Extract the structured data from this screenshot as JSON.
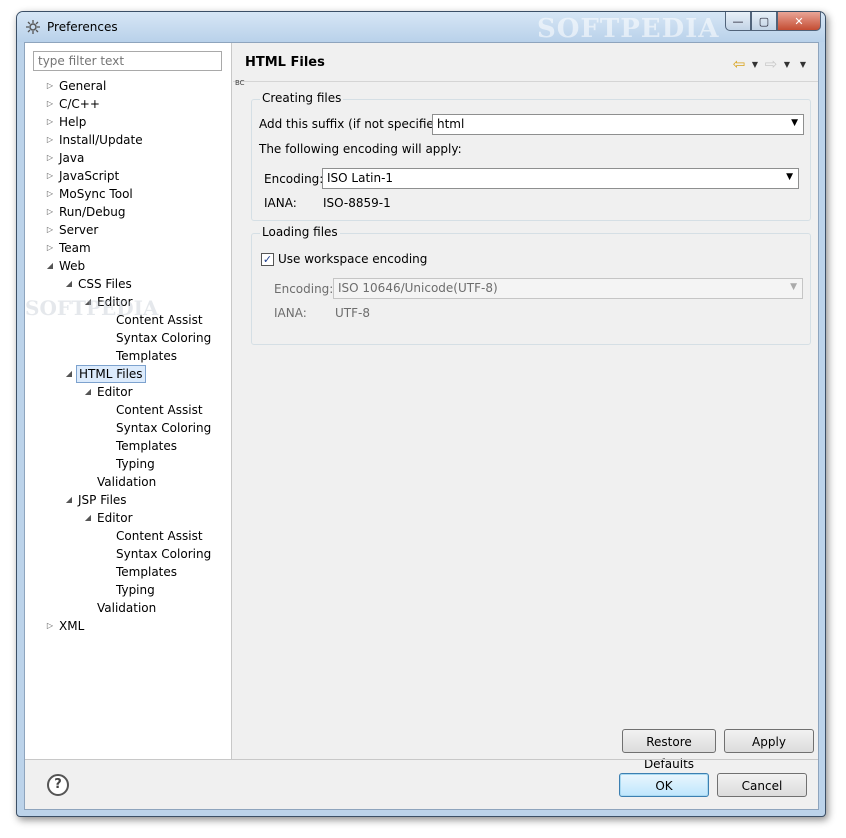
{
  "window": {
    "title": "Preferences",
    "watermark": "SOFTPEDIA",
    "minimize_glyph": "—",
    "maximize_glyph": "▢",
    "close_glyph": "✕"
  },
  "filter": {
    "placeholder": "type filter text",
    "value": ""
  },
  "tree_twisty": {
    "collapsed": "▷",
    "expanded": "◢"
  },
  "tree": [
    {
      "label": "General",
      "level": 0,
      "state": "collapsed"
    },
    {
      "label": "C/C++",
      "level": 0,
      "state": "collapsed"
    },
    {
      "label": "Help",
      "level": 0,
      "state": "collapsed"
    },
    {
      "label": "Install/Update",
      "level": 0,
      "state": "collapsed"
    },
    {
      "label": "Java",
      "level": 0,
      "state": "collapsed"
    },
    {
      "label": "JavaScript",
      "level": 0,
      "state": "collapsed"
    },
    {
      "label": "MoSync Tool",
      "level": 0,
      "state": "collapsed"
    },
    {
      "label": "Run/Debug",
      "level": 0,
      "state": "collapsed"
    },
    {
      "label": "Server",
      "level": 0,
      "state": "collapsed"
    },
    {
      "label": "Team",
      "level": 0,
      "state": "collapsed"
    },
    {
      "label": "Web",
      "level": 0,
      "state": "expanded"
    },
    {
      "label": "CSS Files",
      "level": 1,
      "state": "expanded"
    },
    {
      "label": "Editor",
      "level": 2,
      "state": "expanded"
    },
    {
      "label": "Content Assist",
      "level": 3,
      "state": "leaf"
    },
    {
      "label": "Syntax Coloring",
      "level": 3,
      "state": "leaf"
    },
    {
      "label": "Templates",
      "level": 3,
      "state": "leaf"
    },
    {
      "label": "HTML Files",
      "level": 1,
      "state": "expanded",
      "selected": true
    },
    {
      "label": "Editor",
      "level": 2,
      "state": "expanded"
    },
    {
      "label": "Content Assist",
      "level": 3,
      "state": "leaf"
    },
    {
      "label": "Syntax Coloring",
      "level": 3,
      "state": "leaf"
    },
    {
      "label": "Templates",
      "level": 3,
      "state": "leaf"
    },
    {
      "label": "Typing",
      "level": 3,
      "state": "leaf"
    },
    {
      "label": "Validation",
      "level": 2,
      "state": "leaf"
    },
    {
      "label": "JSP Files",
      "level": 1,
      "state": "expanded"
    },
    {
      "label": "Editor",
      "level": 2,
      "state": "expanded"
    },
    {
      "label": "Content Assist",
      "level": 3,
      "state": "leaf"
    },
    {
      "label": "Syntax Coloring",
      "level": 3,
      "state": "leaf"
    },
    {
      "label": "Templates",
      "level": 3,
      "state": "leaf"
    },
    {
      "label": "Typing",
      "level": 3,
      "state": "leaf"
    },
    {
      "label": "Validation",
      "level": 2,
      "state": "leaf"
    },
    {
      "label": "XML",
      "level": 0,
      "state": "collapsed"
    }
  ],
  "page": {
    "title": "HTML Files",
    "marker": "BC",
    "nav": {
      "back": "⇦",
      "forward": "⇨",
      "dropdown": "▼"
    }
  },
  "creating": {
    "title": "Creating files",
    "suffix_label": "Add this suffix (if not specified):",
    "suffix_value": "html",
    "encoding_note": "The following encoding will apply:",
    "encoding_label": "Encoding:",
    "encoding_value": "ISO Latin-1",
    "iana_label": "IANA:",
    "iana_value": "ISO-8859-1"
  },
  "loading": {
    "title": "Loading files",
    "use_workspace_label": "Use workspace encoding",
    "use_workspace_checked": true,
    "check_glyph": "✓",
    "encoding_label": "Encoding:",
    "encoding_value": "ISO 10646/Unicode(UTF-8)",
    "iana_label": "IANA:",
    "iana_value": "UTF-8"
  },
  "combo_arrow": "▼",
  "buttons": {
    "restore_defaults": "Restore Defaults",
    "apply": "Apply",
    "ok": "OK",
    "cancel": "Cancel",
    "help_glyph": "?"
  }
}
